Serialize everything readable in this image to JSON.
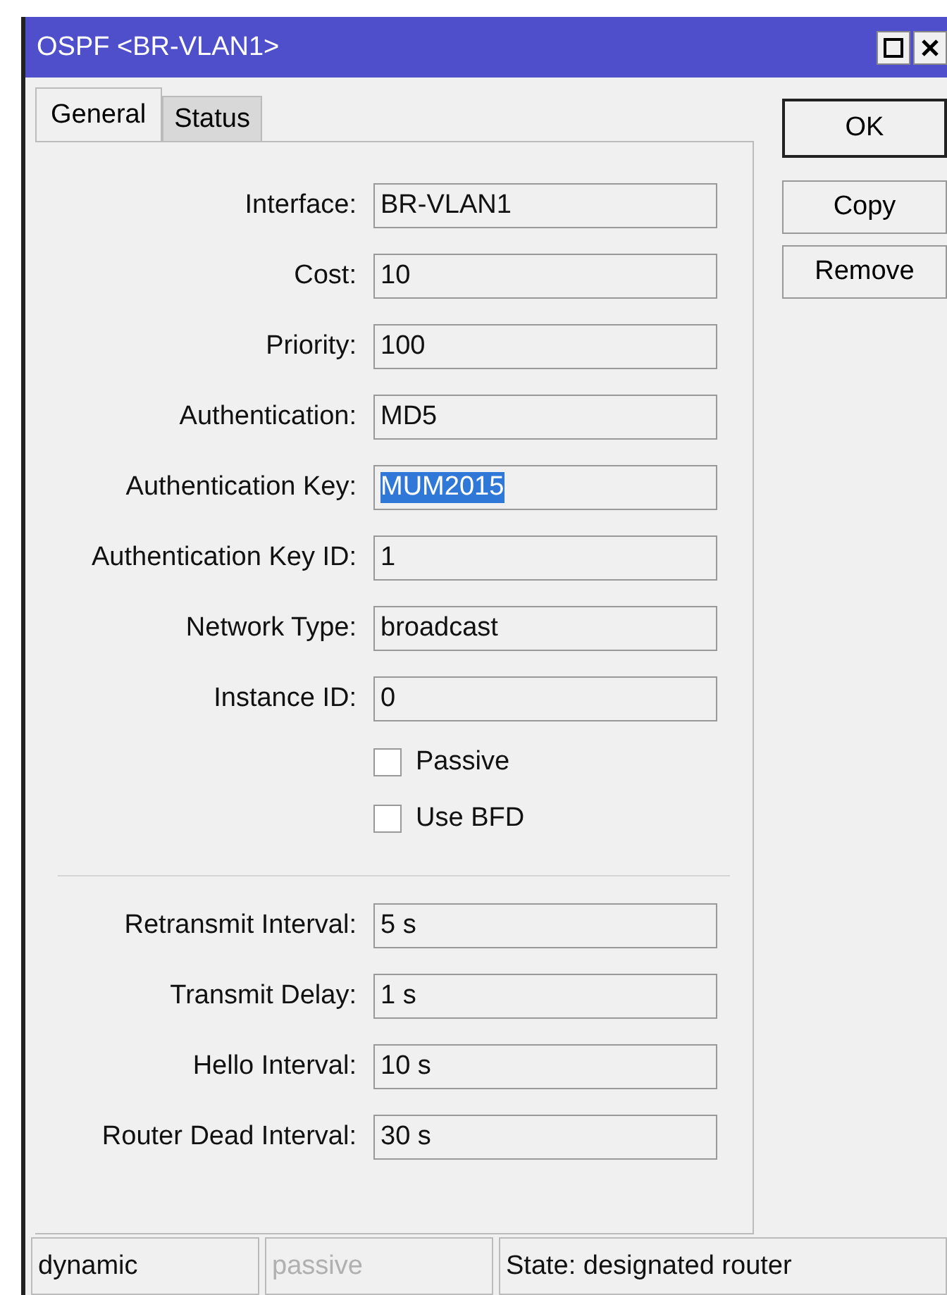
{
  "window": {
    "title": "OSPF <BR-VLAN1>"
  },
  "tabs": [
    {
      "label": "General",
      "selected": true
    },
    {
      "label": "Status",
      "selected": false
    }
  ],
  "fields": [
    {
      "label": "Interface:",
      "value": "BR-VLAN1",
      "highlighted": false
    },
    {
      "label": "Cost:",
      "value": "10",
      "highlighted": false
    },
    {
      "label": "Priority:",
      "value": "100",
      "highlighted": false
    },
    {
      "label": "Authentication:",
      "value": "MD5",
      "highlighted": false
    },
    {
      "label": "Authentication Key:",
      "value": "MUM2015",
      "highlighted": true
    },
    {
      "label": "Authentication Key ID:",
      "value": "1",
      "highlighted": false
    },
    {
      "label": "Network Type:",
      "value": "broadcast",
      "highlighted": false
    },
    {
      "label": "Instance ID:",
      "value": "0",
      "highlighted": false
    }
  ],
  "checkboxes": [
    {
      "label": "Passive",
      "checked": false
    },
    {
      "label": "Use BFD",
      "checked": false
    }
  ],
  "interval_fields": [
    {
      "label": "Retransmit Interval:",
      "value": "5 s"
    },
    {
      "label": "Transmit Delay:",
      "value": "1 s"
    },
    {
      "label": "Hello Interval:",
      "value": "10 s"
    },
    {
      "label": "Router Dead Interval:",
      "value": "30 s"
    }
  ],
  "buttons": [
    "OK",
    "Copy",
    "Remove"
  ],
  "status_bar": [
    {
      "text": "dynamic",
      "disabled": false
    },
    {
      "text": "passive",
      "disabled": true
    },
    {
      "text": "State: designated router",
      "disabled": false
    }
  ]
}
